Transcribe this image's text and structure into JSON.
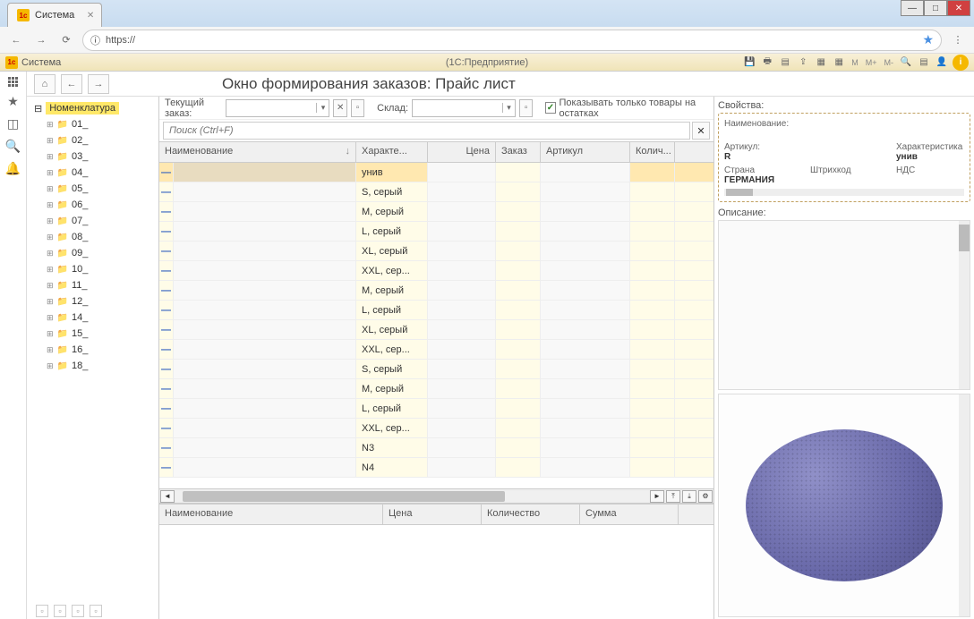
{
  "browser": {
    "tab_title": "Система",
    "url": "https://"
  },
  "onec": {
    "title": "Система",
    "subtitle": "(1С:Предприятие)",
    "scale_labels": [
      "M",
      "M+",
      "M-"
    ]
  },
  "page": {
    "title": "Окно формирования заказов: Прайс лист"
  },
  "order_bar": {
    "current_order_label": "Текущий заказ:",
    "warehouse_label": "Склад:",
    "warehouse_value": "",
    "show_stock_label": "Показывать только товары на остатках"
  },
  "search": {
    "placeholder": "Поиск (Ctrl+F)"
  },
  "tree": {
    "root": "Номенклатура",
    "items": [
      "01_",
      "02_",
      "03_",
      "04_",
      "05_",
      "06_",
      "07_",
      "08_",
      "09_",
      "10_",
      "11_",
      "12_",
      "14_",
      "15_",
      "16_",
      "18_"
    ]
  },
  "grid": {
    "headers": {
      "name": "Наименование",
      "kh": "Характе...",
      "price": "Цена",
      "order": "Заказ",
      "article": "Артикул",
      "qty": "Колич..."
    },
    "rows": [
      {
        "kh": "унив"
      },
      {
        "kh": "S, серый"
      },
      {
        "kh": "M, серый"
      },
      {
        "kh": "L, серый"
      },
      {
        "kh": "XL, серый"
      },
      {
        "kh": "XXL, сер..."
      },
      {
        "kh": "M, серый"
      },
      {
        "kh": "L, серый"
      },
      {
        "kh": "XL, серый"
      },
      {
        "kh": "XXL, сер..."
      },
      {
        "kh": "S, серый"
      },
      {
        "kh": "M, серый"
      },
      {
        "kh": "L, серый"
      },
      {
        "kh": "XXL, сер..."
      },
      {
        "kh": "N3"
      },
      {
        "kh": "N4"
      }
    ]
  },
  "lower_grid": {
    "headers": {
      "name": "Наименование",
      "price": "Цена",
      "qty": "Количество",
      "sum": "Сумма"
    }
  },
  "props": {
    "panel_label": "Свойства:",
    "name_label": "Наименование:",
    "article_label": "Артикул:",
    "article_value": "R",
    "char_label": "Характеристика",
    "char_value": "унив",
    "country_label": "Страна",
    "country_value": "ГЕРМАНИЯ",
    "barcode_label": "Штрихкод",
    "vat_label": "НДС",
    "desc_label": "Описание:"
  }
}
